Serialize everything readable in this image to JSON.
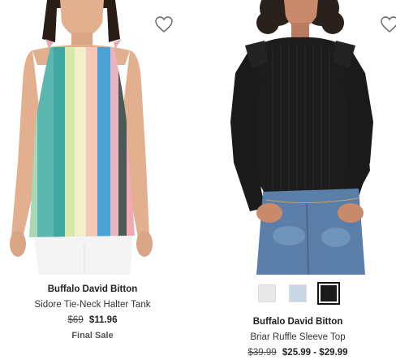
{
  "products": [
    {
      "brand": "Buffalo David Bitton",
      "name": "Sidore Tie-Neck Halter Tank",
      "original_price": "$69",
      "sale_price": "$11.96",
      "note": "Final Sale",
      "favorite_icon": "heart-outline-icon"
    },
    {
      "brand": "Buffalo David Bitton",
      "name": "Briar Ruffle Sleeve Top",
      "original_price": "$39.99",
      "sale_price": "$25.99 - $29.99",
      "favorite_icon": "heart-outline-icon",
      "swatches": [
        {
          "color": "#e8e8e8",
          "selected": false
        },
        {
          "color": "#c9d6e3",
          "selected": false
        },
        {
          "color": "#1a1a1a",
          "selected": true
        }
      ]
    }
  ],
  "colors": {
    "text": "#222222",
    "swatch_border": "#111111"
  }
}
